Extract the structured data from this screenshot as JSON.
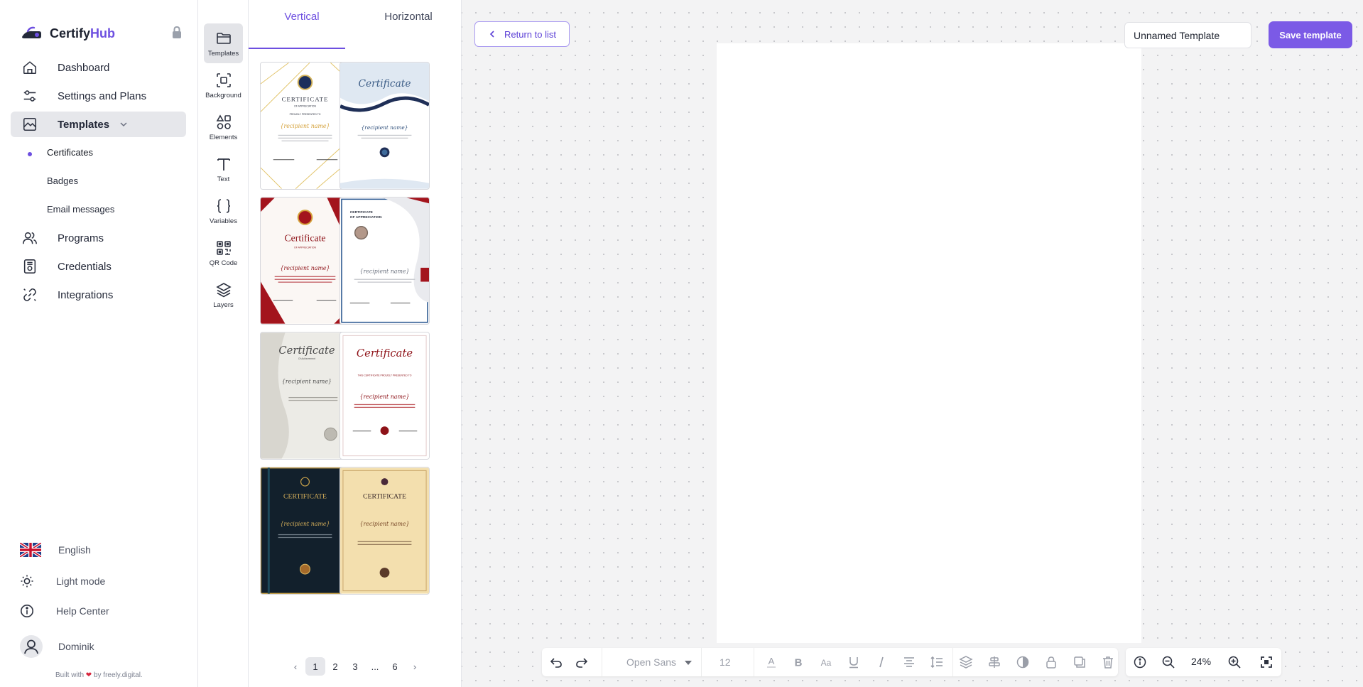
{
  "brand": {
    "name_a": "Certify",
    "name_b": "Hub"
  },
  "nav": {
    "items": [
      {
        "label": "Dashboard"
      },
      {
        "label": "Settings and Plans"
      },
      {
        "label": "Templates"
      },
      {
        "label": "Programs"
      },
      {
        "label": "Credentials"
      },
      {
        "label": "Integrations"
      }
    ],
    "sub_items": [
      {
        "label": "Certificates"
      },
      {
        "label": "Badges"
      },
      {
        "label": "Email messages"
      }
    ]
  },
  "footer": {
    "language": "English",
    "theme": "Light mode",
    "help": "Help Center",
    "user": "Dominik",
    "built_a": "Built with",
    "built_b": "by freely.digital."
  },
  "rail": {
    "tools": [
      {
        "label": "Templates",
        "icon": "folder-icon"
      },
      {
        "label": "Background",
        "icon": "background-icon"
      },
      {
        "label": "Elements",
        "icon": "elements-icon"
      },
      {
        "label": "Text",
        "icon": "text-icon"
      },
      {
        "label": "Variables",
        "icon": "braces-icon"
      },
      {
        "label": "QR Code",
        "icon": "qr-code-icon"
      },
      {
        "label": "Layers",
        "icon": "layers-icon"
      }
    ]
  },
  "panel": {
    "tabs": [
      {
        "label": "Vertical"
      },
      {
        "label": "Horizontal"
      }
    ],
    "pagination": {
      "pages": [
        "1",
        "2",
        "3",
        "...",
        "6"
      ],
      "current": "1"
    }
  },
  "editor": {
    "return_label": "Return to list",
    "template_name": "Unnamed Template",
    "save_label": "Save template",
    "font_family": "Open Sans",
    "font_size": "12",
    "zoom": "24%"
  },
  "colors": {
    "accent": "#6d4fe0",
    "save_button": "#7b5ae6",
    "canvas_bg": "#f3f3f4",
    "active_nav": "#e6e7eb"
  }
}
